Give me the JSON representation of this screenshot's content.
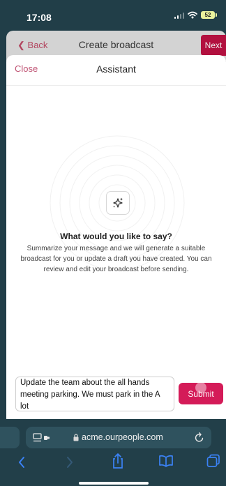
{
  "status_bar": {
    "time": "17:08",
    "battery": "52"
  },
  "background_header": {
    "back_label": "Back",
    "title": "Create broadcast",
    "next_label": "Next"
  },
  "assistant": {
    "close_label": "Close",
    "title": "Assistant",
    "prompt_title": "What would you like to say?",
    "prompt_description": "Summarize your message and we will generate a suitable broadcast for you or update a draft you have created. You can review and edit your broadcast before sending.",
    "input_value": "Update the team about the all hands meeting parking. We must park in the A lot",
    "submit_label": "Submit"
  },
  "browser": {
    "url": "acme.ourpeople.com"
  },
  "colors": {
    "accent": "#d41b58",
    "link": "#c05474",
    "chrome": "#213e48"
  }
}
